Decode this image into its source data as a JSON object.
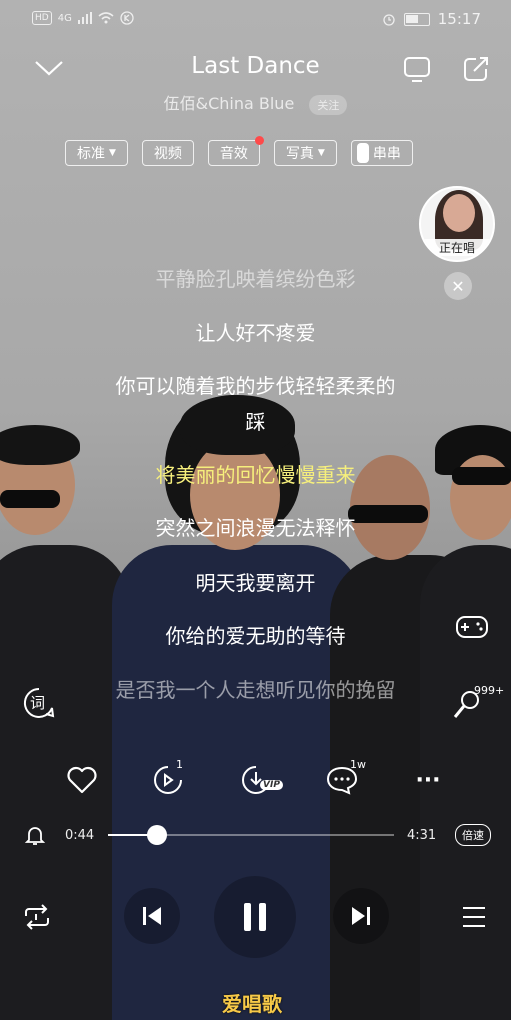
{
  "status_bar": {
    "net1": "HD",
    "net2": "4G",
    "time": "15:17"
  },
  "header": {
    "title": "Last Dance",
    "artist": "伍佰&China Blue",
    "follow_label": "关注"
  },
  "chips": [
    {
      "label": "标准"
    },
    {
      "label": "视频"
    },
    {
      "label": "音效"
    },
    {
      "label": "写真"
    },
    {
      "label": "串串"
    }
  ],
  "singing_widget": {
    "label": "正在唱"
  },
  "lyrics": [
    "平静脸孔映着缤纷色彩",
    "让人好不疼爱",
    "你可以随着我的步伐轻轻柔柔的",
    "踩",
    "将美丽的回忆慢慢重来",
    "突然之间浪漫无法释怀",
    "明天我要离开",
    "你给的爱无助的等待",
    "是否我一个人走想听见你的挽留"
  ],
  "side_buttons": {
    "lyric_label": "词",
    "comment_count": "999+"
  },
  "actions": {
    "share_count": "1",
    "download_badge": "VIP",
    "comment_count": "1w",
    "more_label": "···"
  },
  "playback": {
    "current_time": "0:44",
    "total_time": "4:31",
    "progress": 0.17,
    "speed_label": "倍速"
  },
  "watermark": "爱唱歌",
  "colors": {
    "current_lyric": "#f6ef7c",
    "accent_dot": "#ff4a4a"
  }
}
